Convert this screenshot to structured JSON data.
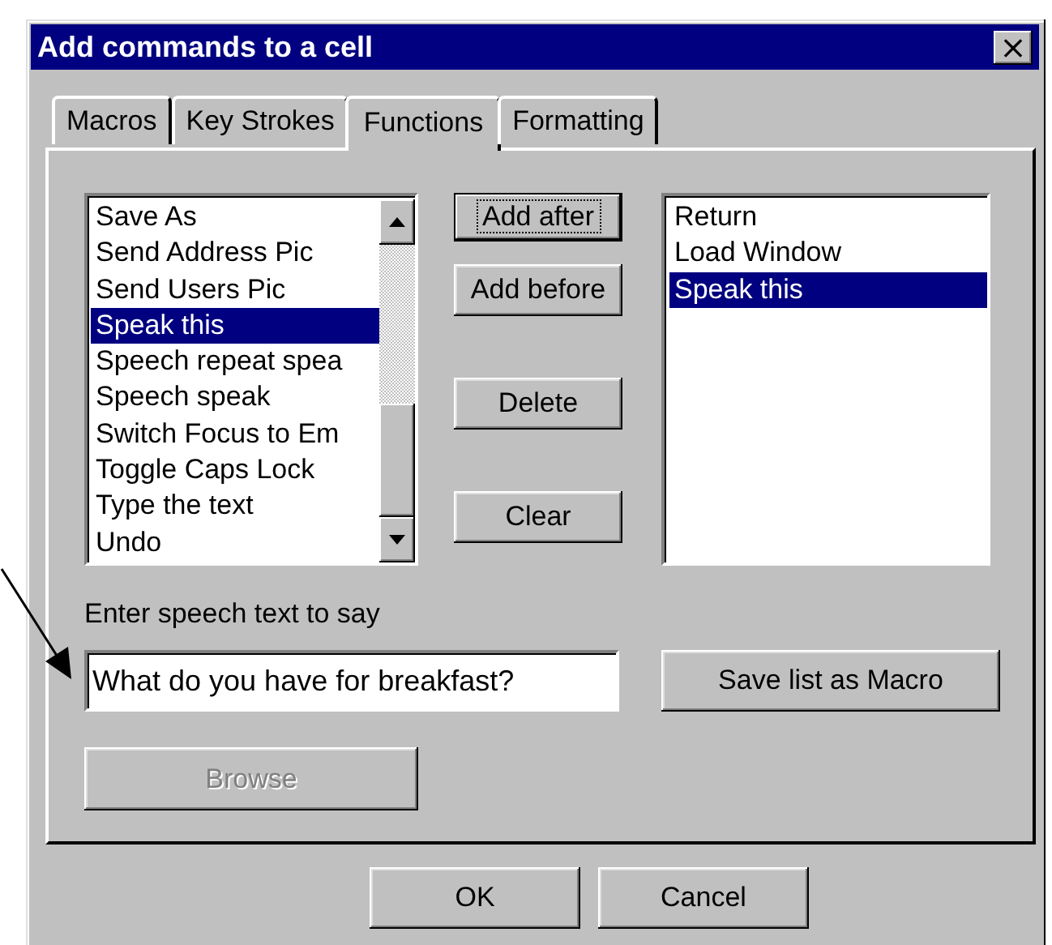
{
  "window": {
    "title": "Add commands to a cell",
    "close": "×"
  },
  "tabs": [
    {
      "label": "Macros",
      "selected": false
    },
    {
      "label": "Key Strokes",
      "selected": false
    },
    {
      "label": "Functions",
      "selected": true
    },
    {
      "label": "Formatting",
      "selected": false
    }
  ],
  "functions_list": {
    "items": [
      {
        "label": "Save As",
        "selected": false
      },
      {
        "label": "Send Address Pic",
        "selected": false
      },
      {
        "label": "Send Users Pic",
        "selected": false
      },
      {
        "label": "Speak this",
        "selected": true
      },
      {
        "label": "Speech repeat spea",
        "selected": false
      },
      {
        "label": "Speech speak",
        "selected": false
      },
      {
        "label": "Switch Focus to Em",
        "selected": false
      },
      {
        "label": "Toggle Caps Lock",
        "selected": false
      },
      {
        "label": "Type the text",
        "selected": false
      },
      {
        "label": "Undo",
        "selected": false
      }
    ]
  },
  "actions": [
    {
      "label": "Add after",
      "focused": true
    },
    {
      "label": "Add before",
      "focused": false
    },
    {
      "label": "Delete",
      "focused": false
    },
    {
      "label": "Clear",
      "focused": false
    }
  ],
  "command_list": {
    "items": [
      {
        "label": "Return",
        "selected": false
      },
      {
        "label": "Load Window",
        "selected": false
      },
      {
        "label": "Speak this",
        "selected": true
      }
    ]
  },
  "speech": {
    "label": "Enter speech text to say",
    "value": "What do you have for breakfast?"
  },
  "save_button": {
    "label": "Save list as Macro"
  },
  "browse_button": {
    "label": "Browse",
    "disabled": true
  },
  "footer_buttons": [
    {
      "label": "OK"
    },
    {
      "label": "Cancel"
    }
  ]
}
